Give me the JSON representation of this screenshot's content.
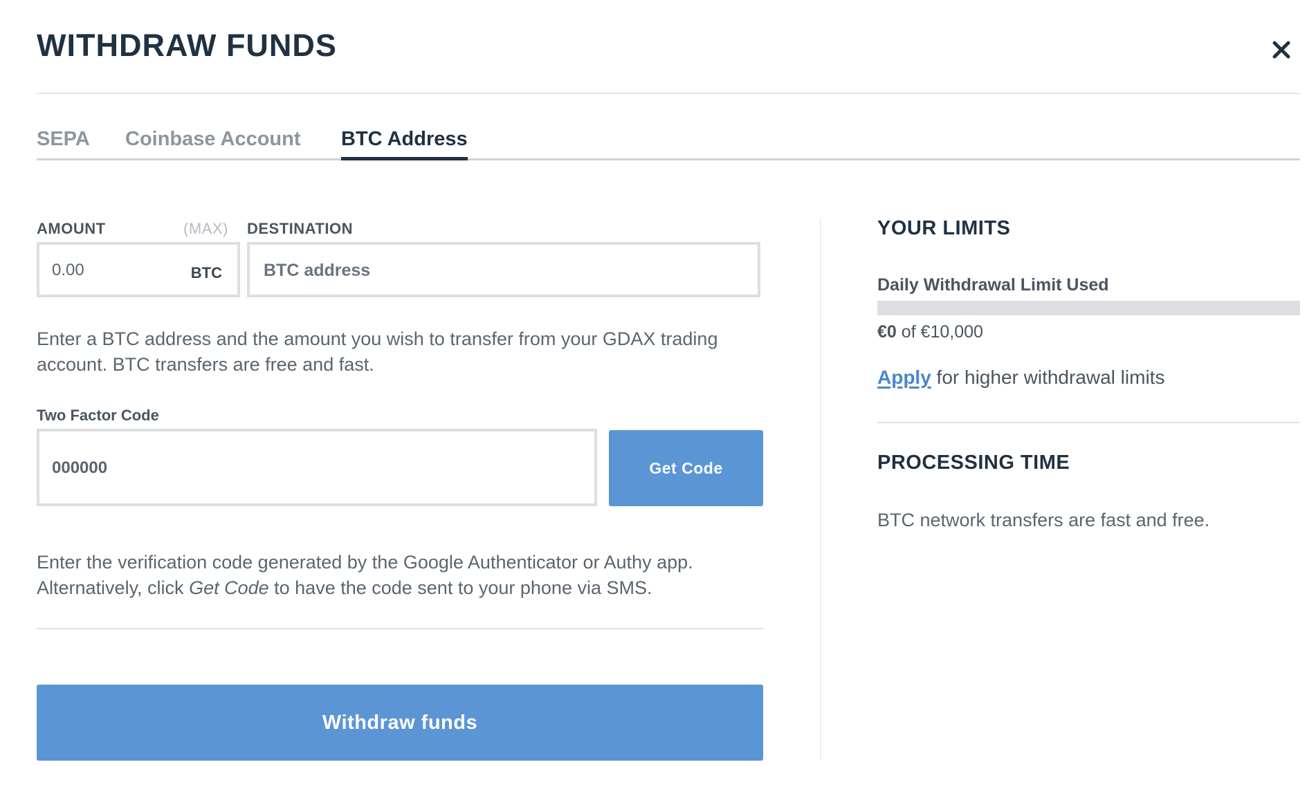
{
  "modal": {
    "title": "WITHDRAW FUNDS",
    "close_icon": "close-icon"
  },
  "tabs": [
    {
      "label": "SEPA",
      "active": false
    },
    {
      "label": "Coinbase Account",
      "active": false
    },
    {
      "label": "BTC Address",
      "active": true
    }
  ],
  "form": {
    "amount_label": "AMOUNT",
    "max_label": "(MAX)",
    "amount_placeholder": "0.00",
    "amount_unit": "BTC",
    "destination_label": "DESTINATION",
    "destination_placeholder": "BTC address",
    "description": "Enter a BTC address and the amount you wish to transfer from your GDAX trading account. BTC transfers are free and fast.",
    "two_factor_label": "Two Factor Code",
    "two_factor_placeholder": "000000",
    "get_code_label": "Get Code",
    "verification_text_1": "Enter the verification code generated by the Google Authenticator or Authy app. Alternatively, click ",
    "verification_emphasis": "Get Code",
    "verification_text_2": " to have the code sent to your phone via SMS.",
    "submit_label": "Withdraw funds"
  },
  "limits": {
    "heading": "YOUR LIMITS",
    "daily_label": "Daily Withdrawal Limit Used",
    "used_fraction": 0,
    "used_amount": "€0",
    "of_text": " of €10,000",
    "apply_link": "Apply",
    "apply_text": " for higher withdrawal limits"
  },
  "processing": {
    "heading": "PROCESSING TIME",
    "text": "BTC network transfers are fast and free."
  },
  "colors": {
    "accent": "#5b95d6",
    "link": "#4a86cc",
    "heading": "#1f3142"
  }
}
